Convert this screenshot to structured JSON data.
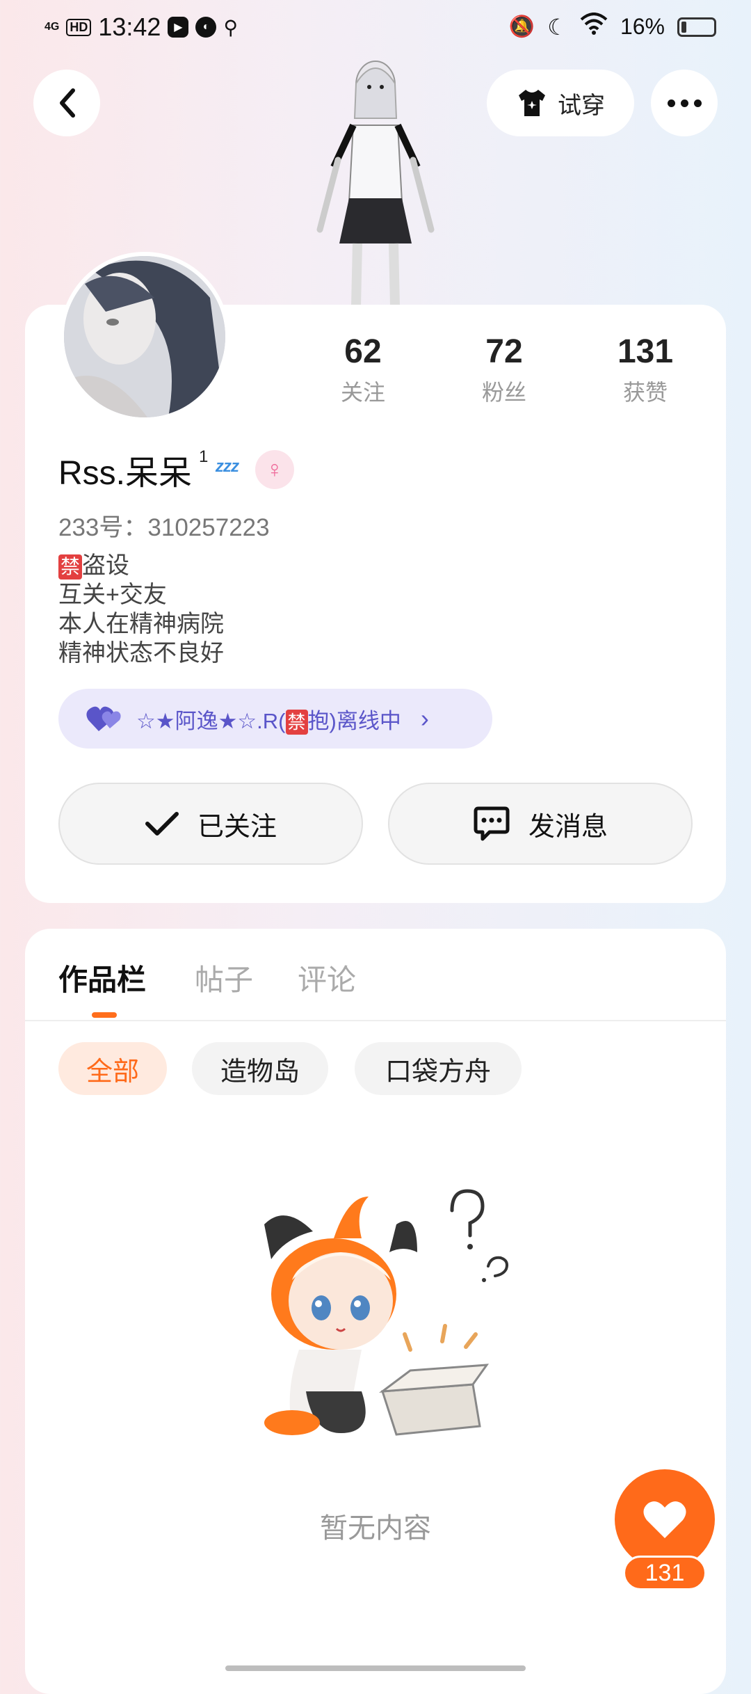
{
  "status_bar": {
    "network": "4G",
    "hd": "HD",
    "time": "13:42",
    "battery": "16%",
    "battery_level": 0.16
  },
  "header": {
    "tryon_label": "试穿"
  },
  "profile": {
    "stats": [
      {
        "num": "62",
        "label": "关注"
      },
      {
        "num": "72",
        "label": "粉丝"
      },
      {
        "num": "131",
        "label": "获赞"
      }
    ],
    "username": "Rss.呆呆",
    "level": "1",
    "zzz": "ᶻᶻᶻ",
    "gender_symbol": "♀",
    "uid": "233号：310257223",
    "bio_ban": "禁",
    "bio_lines": [
      "盗设",
      "互关+交友",
      "本人在精神病院",
      "精神状态不良好"
    ],
    "relation": {
      "prefix": "☆★阿逸★☆.R(",
      "ban": "禁",
      "suffix": "抱)离线中"
    },
    "follow_label": "已关注",
    "message_label": "发消息"
  },
  "tabs": [
    "作品栏",
    "帖子",
    "评论"
  ],
  "chips": [
    "全部",
    "造物岛",
    "口袋方舟"
  ],
  "empty_text": "暂无内容",
  "likes": "131",
  "colors": {
    "accent": "#ff6a1a",
    "relation_bg": "#ebe9fb",
    "relation_text": "#5a55c9"
  }
}
